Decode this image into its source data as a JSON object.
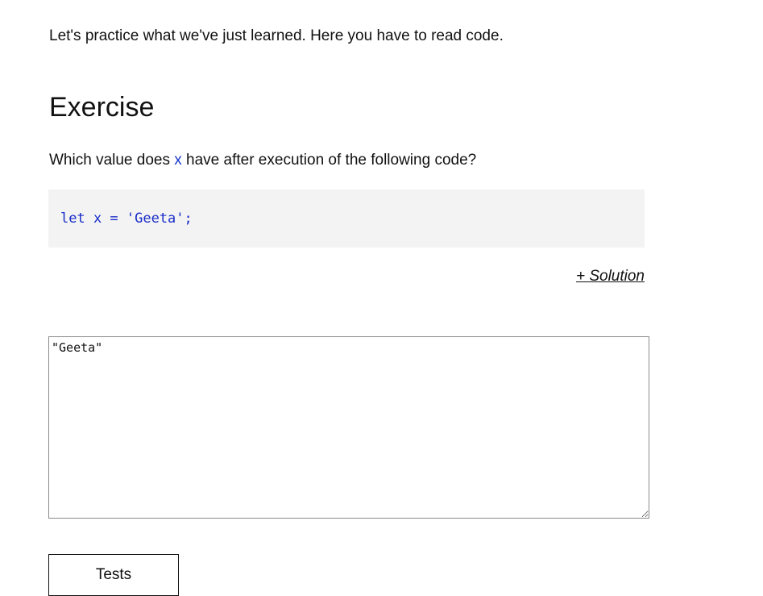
{
  "intro": {
    "text": "Let's practice what we've just learned. Here you have to read code."
  },
  "exercise": {
    "heading": "Exercise",
    "question_before": "Which value does ",
    "question_var": "x",
    "question_after": " have after execution of the following code?",
    "code": "let x = 'Geeta';",
    "solution_link": "+ Solution"
  },
  "answer": {
    "value": "\"Geeta\""
  },
  "actions": {
    "tests_label": "Tests"
  },
  "colors": {
    "code_text": "#1a2ec9",
    "code_background": "#f3f3f3",
    "variable_highlight": "#1a3ccc"
  }
}
